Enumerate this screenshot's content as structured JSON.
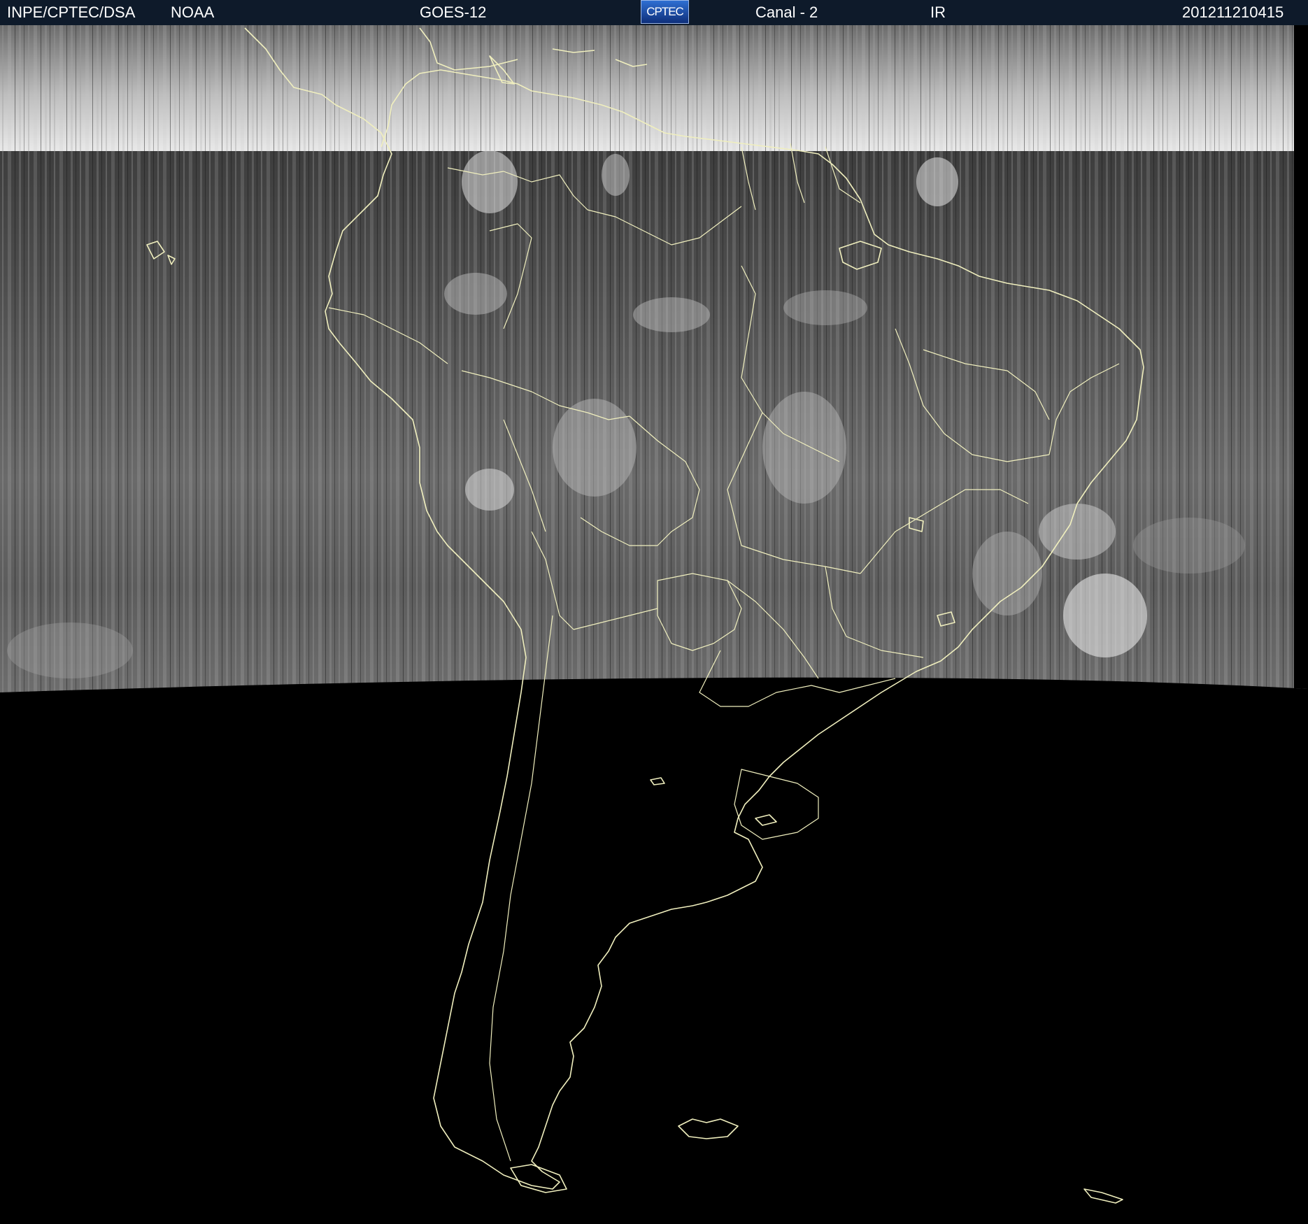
{
  "header": {
    "org": "INPE/CPTEC/DSA",
    "agency": "NOAA",
    "satellite": "GOES-12",
    "logo_text": "CPTEC",
    "channel": "Canal - 2",
    "band": "IR",
    "timestamp": "201211210415"
  },
  "colors": {
    "header_bg": "#0e1a2a",
    "map_lines": "#f0efbe",
    "no_data": "#000000",
    "cloud_gray_dark": "#3a3a3a",
    "cloud_gray_light": "#d8d8d8"
  },
  "map": {
    "region": "South America",
    "image_type": "satellite infrared",
    "coverage": "partial scan, no data over southern South America"
  }
}
